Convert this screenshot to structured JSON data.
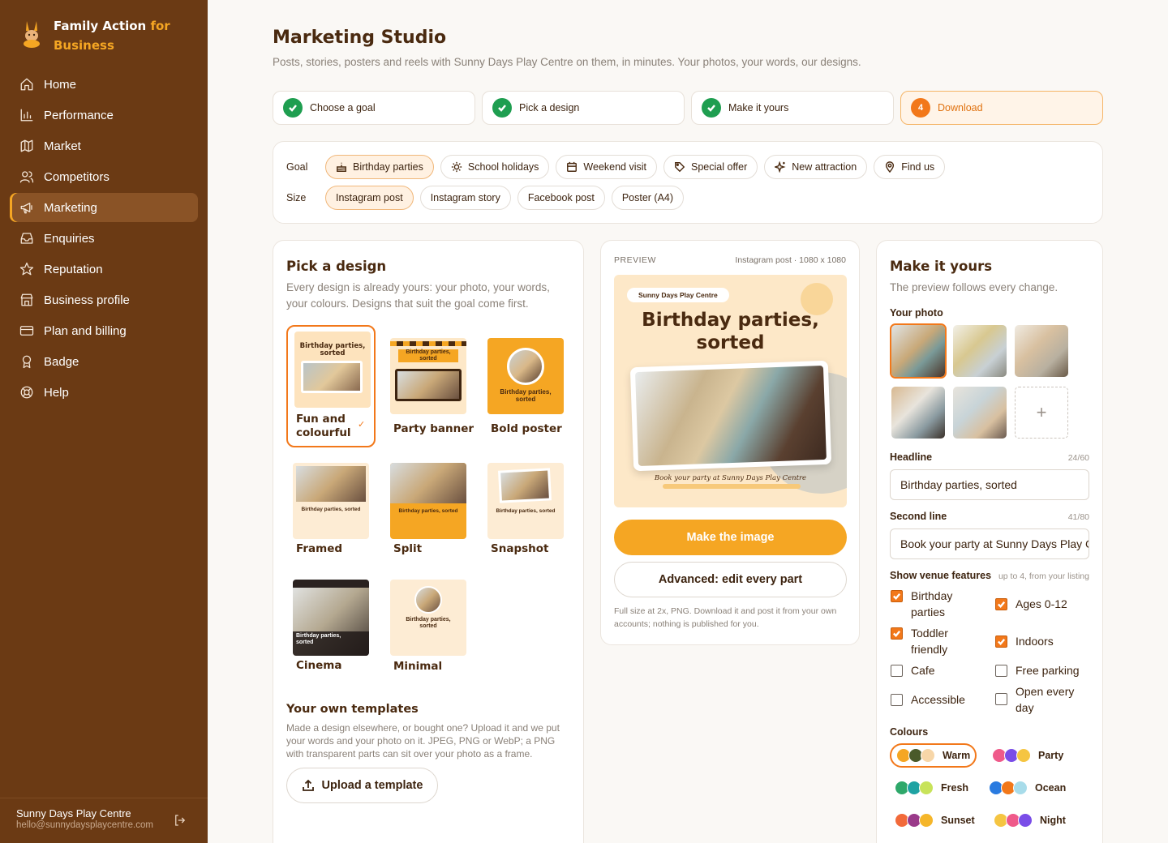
{
  "brand": {
    "name_part1": "Family Action",
    "name_accent": "for",
    "name_part2": "Business"
  },
  "nav": [
    {
      "label": "Home",
      "icon": "home-icon"
    },
    {
      "label": "Performance",
      "icon": "bar-chart-icon"
    },
    {
      "label": "Market",
      "icon": "map-icon"
    },
    {
      "label": "Competitors",
      "icon": "users-icon"
    },
    {
      "label": "Marketing",
      "icon": "megaphone-icon",
      "active": true
    },
    {
      "label": "Enquiries",
      "icon": "inbox-icon"
    },
    {
      "label": "Reputation",
      "icon": "star-icon"
    },
    {
      "label": "Business profile",
      "icon": "store-icon"
    },
    {
      "label": "Plan and billing",
      "icon": "credit-card-icon"
    },
    {
      "label": "Badge",
      "icon": "award-icon"
    },
    {
      "label": "Help",
      "icon": "lifebuoy-icon"
    }
  ],
  "account": {
    "name": "Sunny Days Play Centre",
    "email": "hello@sunnydaysplaycentre.com"
  },
  "page": {
    "title": "Marketing Studio",
    "subtitle": "Posts, stories, posters and reels with Sunny Days Play Centre on them, in minutes. Your photos, your words, our designs."
  },
  "steps": [
    {
      "label": "Choose a goal",
      "done": true
    },
    {
      "label": "Pick a design",
      "done": true
    },
    {
      "label": "Make it yours",
      "done": true
    },
    {
      "label": "Download",
      "number": "4",
      "current": true
    }
  ],
  "filters": {
    "goal_label": "Goal",
    "goals": [
      {
        "label": "Birthday parties",
        "icon": "cake-icon",
        "selected": true
      },
      {
        "label": "School holidays",
        "icon": "sun-icon"
      },
      {
        "label": "Weekend visit",
        "icon": "calendar-icon"
      },
      {
        "label": "Special offer",
        "icon": "tag-icon"
      },
      {
        "label": "New attraction",
        "icon": "sparkles-icon"
      },
      {
        "label": "Find us",
        "icon": "map-pin-icon"
      }
    ],
    "size_label": "Size",
    "sizes": [
      {
        "label": "Instagram post",
        "selected": true
      },
      {
        "label": "Instagram story"
      },
      {
        "label": "Facebook post"
      },
      {
        "label": "Poster (A4)"
      }
    ]
  },
  "design": {
    "title": "Pick a design",
    "desc": "Every design is already yours: your photo, your words, your colours. Designs that suit the goal come first.",
    "tiles": [
      {
        "label": "Fun and colourful",
        "selected": true
      },
      {
        "label": "Party banner"
      },
      {
        "label": "Bold poster"
      },
      {
        "label": "Framed"
      },
      {
        "label": "Split"
      },
      {
        "label": "Snapshot"
      },
      {
        "label": "Cinema"
      },
      {
        "label": "Minimal"
      }
    ],
    "thumb_headline": "Birthday parties, sorted",
    "own_title": "Your own templates",
    "own_desc": "Made a design elsewhere, or bought one? Upload it and we put your words and your photo on it. JPEG, PNG or WebP; a PNG with transparent parts can sit over your photo as a frame.",
    "upload_label": "Upload a template"
  },
  "preview": {
    "label": "PREVIEW",
    "size": "Instagram post · 1080 x 1080",
    "badge": "Sunny Days Play Centre",
    "headline_1": "Birthday parties,",
    "headline_2": "sorted",
    "tagline": "Book your party at Sunny Days Play Centre",
    "make_label": "Make the image",
    "advanced_label": "Advanced: edit every part",
    "note": "Full size at 2x, PNG. Download it and post it from your own accounts; nothing is published for you."
  },
  "yours": {
    "title": "Make it yours",
    "desc": "The preview follows every change.",
    "photo_label": "Your photo",
    "add_photo": "+",
    "headline_label": "Headline",
    "headline_count": "24/60",
    "headline_value": "Birthday parties, sorted",
    "second_label": "Second line",
    "second_count": "41/80",
    "second_value": "Book your party at Sunny Days Play Centre",
    "features_label": "Show venue features",
    "features_hint": "up to 4, from your listing",
    "features": [
      {
        "label": "Birthday parties",
        "checked": true
      },
      {
        "label": "Ages 0-12",
        "checked": true
      },
      {
        "label": "Toddler friendly",
        "checked": true
      },
      {
        "label": "Indoors",
        "checked": true
      },
      {
        "label": "Cafe",
        "checked": false
      },
      {
        "label": "Free parking",
        "checked": false
      },
      {
        "label": "Accessible",
        "checked": false
      },
      {
        "label": "Open every day",
        "checked": false
      }
    ],
    "colours_label": "Colours",
    "palettes": [
      {
        "name": "Warm",
        "colors": [
          "#f5a623",
          "#4a5a2a",
          "#f7d6a8"
        ],
        "selected": true
      },
      {
        "name": "Party",
        "colors": [
          "#ef5a8a",
          "#7a4de8",
          "#f5c542"
        ]
      },
      {
        "name": "Fresh",
        "colors": [
          "#2ea86a",
          "#1fa3a3",
          "#c8e35a"
        ]
      },
      {
        "name": "Ocean",
        "colors": [
          "#2a7be0",
          "#f2781a",
          "#a8dcea"
        ]
      },
      {
        "name": "Sunset",
        "colors": [
          "#f26a3a",
          "#9a3a8a",
          "#f5b62a"
        ]
      },
      {
        "name": "Night",
        "colors": [
          "#f5c542",
          "#ef5a8a",
          "#7a4de8"
        ]
      }
    ]
  }
}
